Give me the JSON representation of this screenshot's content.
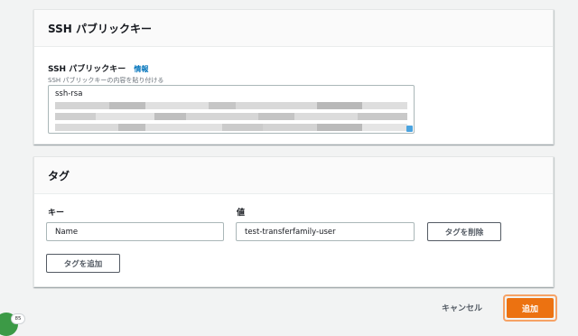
{
  "ssh_panel": {
    "title": "SSH パブリックキー",
    "field_label": "SSH パブリックキー",
    "info_link": "情報",
    "description": "SSH パブリックキーの内容を貼り付ける",
    "value": "ssh-rsa"
  },
  "tags_panel": {
    "title": "タグ",
    "key_label": "キー",
    "value_label": "値",
    "key_value": "Name",
    "value_value": "test-transferfamily-user",
    "remove_label": "タグを削除",
    "add_tag_label": "タグを追加"
  },
  "footer": {
    "cancel_label": "キャンセル",
    "submit_label": "追加"
  },
  "badge": {
    "count": "85"
  },
  "colors": {
    "primary": "#ec7211",
    "link": "#0073bb",
    "focus_ring": "#f6a265"
  }
}
